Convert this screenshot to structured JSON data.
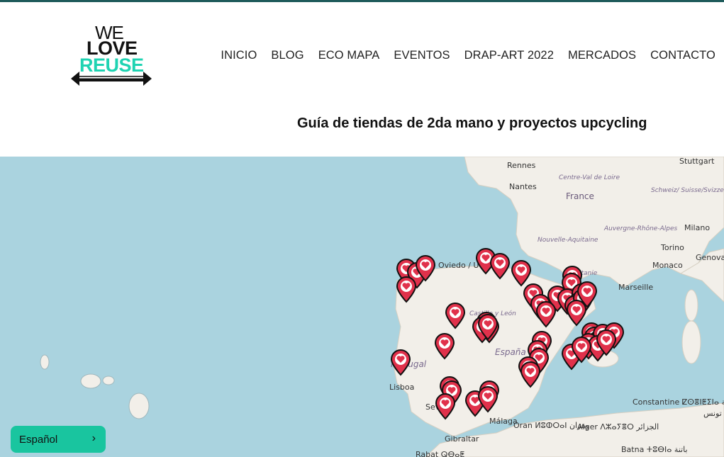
{
  "brand": {
    "logo_line1": "WE",
    "logo_line2": "LOVE",
    "logo_line3": "REUSE"
  },
  "nav": {
    "items": [
      "INICIO",
      "BLOG",
      "ECO MAPA",
      "EVENTOS",
      "DRAP-ART 2022",
      "MERCADOS",
      "CONTACTO"
    ]
  },
  "page": {
    "subtitle": "Guía de tiendas de 2da mano y proyectos upcycling"
  },
  "map": {
    "labels": {
      "rennes": "Rennes",
      "nantes": "Nantes",
      "centre_val_de_loire": "Centre-Val de Loire",
      "france": "France",
      "stuttgart": "Stuttgart",
      "schweiz": "Schweiz/ Suisse/Svizzera/ Svizra",
      "nouvelle_aquitaine": "Nouvelle-Aquitaine",
      "auvergne": "Auvergne-Rhône-Alpes",
      "milano": "Milano",
      "torino": "Torino",
      "monaco": "Monaco",
      "genova": "Genova",
      "occitanie": "Occitanie",
      "marseille": "Marseille",
      "oviedo": "Oviedo / Uviéu",
      "castilla": "Castilla y León",
      "espana": "España",
      "portugal": "Portugal",
      "lisboa": "Lisboa",
      "sevilla": "Sevilla",
      "malaga": "Málaga",
      "gibraltar": "Gibraltar",
      "oran": "Oran ⵍⵓⵀⵔⴰⵏ وهران",
      "alger": "Alger ⴷⵣⴰⵢⴻⵔ الجزائر",
      "constantine": "Constantine ⵇⵙⴻⵏⵟⵉⵏⴰ قسنطينة",
      "batna": "Batna ⵜⵓⴱⵏⴰ باتنة",
      "rabat": "Rabat ⵕⴱⴰⵟ",
      "tunis": "تونس"
    },
    "marker_color": "#e0314b",
    "marker_count": 48
  },
  "language": {
    "label": "Español",
    "chevron": "›"
  }
}
